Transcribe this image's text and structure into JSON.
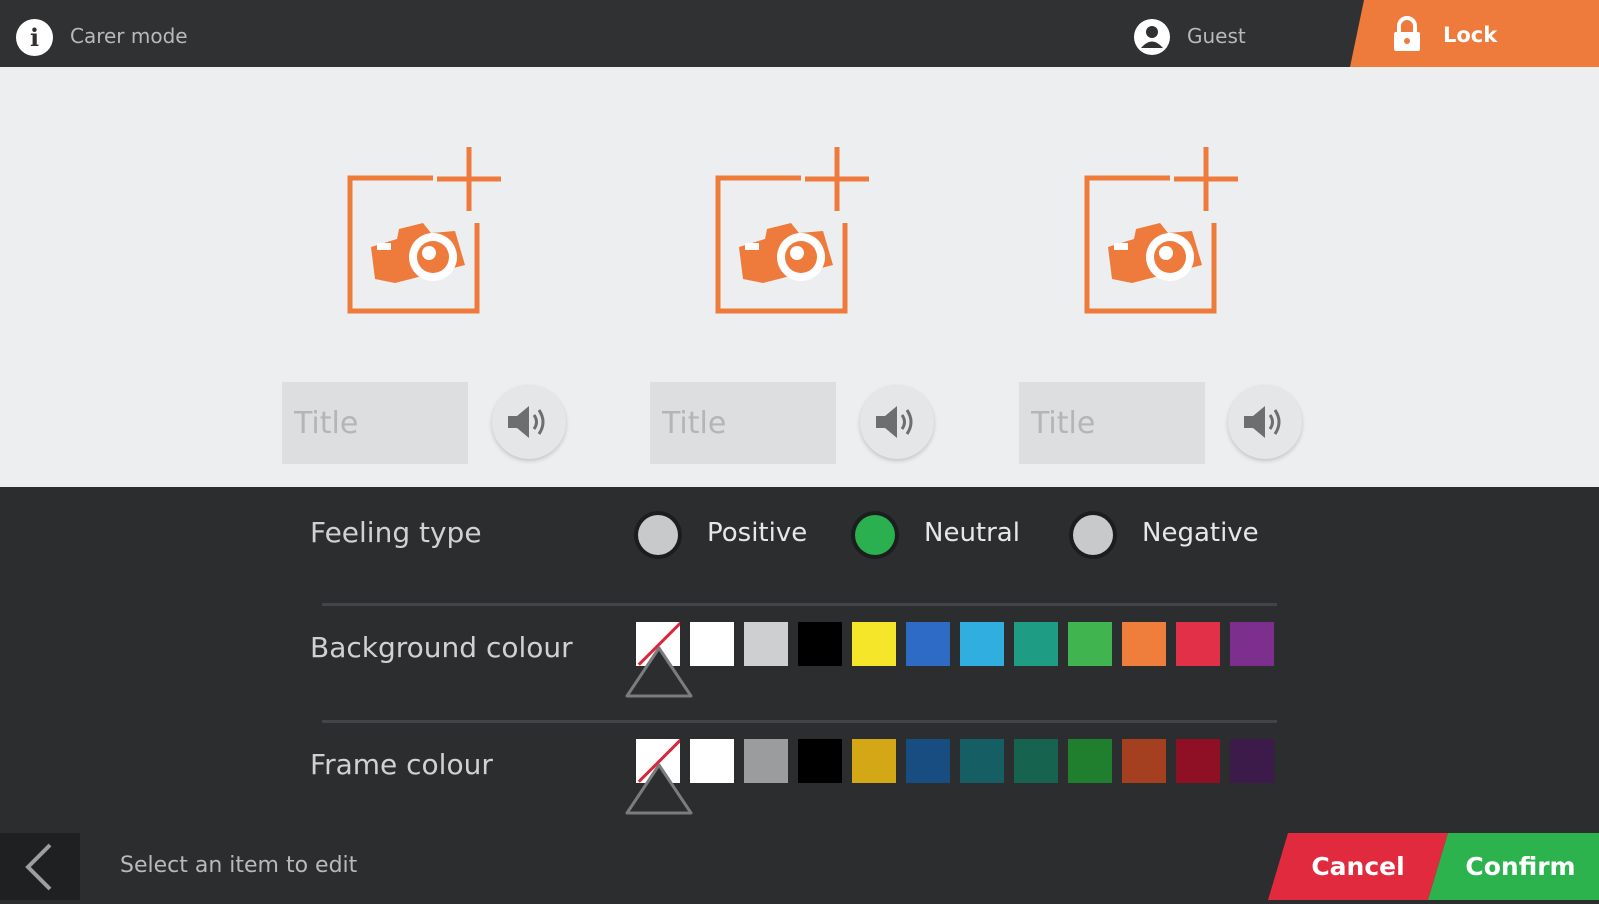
{
  "header": {
    "mode_label": "Carer mode",
    "user_label": "Guest",
    "lock_label": "Lock"
  },
  "cards": [
    {
      "title_placeholder": "Title"
    },
    {
      "title_placeholder": "Title"
    },
    {
      "title_placeholder": "Title"
    }
  ],
  "feeling": {
    "label": "Feeling type",
    "options": [
      "Positive",
      "Neutral",
      "Negative"
    ],
    "selected": "Neutral"
  },
  "background_colour": {
    "label": "Background colour",
    "swatches": [
      "none",
      "#ffffff",
      "#cdcfd0",
      "#000000",
      "#f5e62a",
      "#2d6bc4",
      "#31aee0",
      "#1f9d84",
      "#3fb44f",
      "#ef7d3b",
      "#e23048",
      "#7d2f8e"
    ],
    "selected_index": 0
  },
  "frame_colour": {
    "label": "Frame colour",
    "swatches": [
      "none",
      "#ffffff",
      "#9a9c9e",
      "#000000",
      "#d3a716",
      "#184d82",
      "#155e63",
      "#16644f",
      "#1f7f2e",
      "#a4401f",
      "#8f0f24",
      "#3c1a4a"
    ],
    "selected_index": 0
  },
  "footer": {
    "status": "Select an item to edit",
    "cancel_label": "Cancel",
    "confirm_label": "Confirm"
  },
  "colors": {
    "accent_orange": "#ee7a3c",
    "confirm_green": "#2cb34e",
    "cancel_red": "#e12a3e",
    "radio_selected": "#2bb04f",
    "radio_unselected": "#c8c9cb"
  }
}
